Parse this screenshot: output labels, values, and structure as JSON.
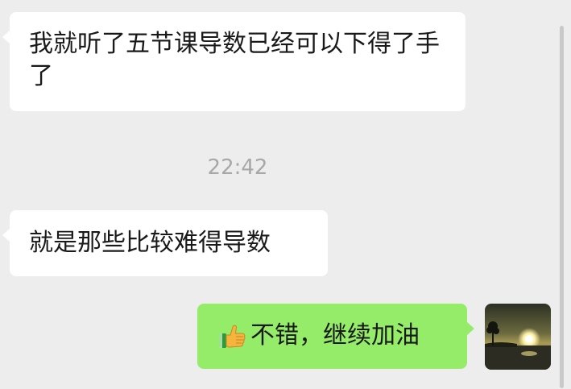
{
  "messages": [
    {
      "direction": "incoming",
      "text": "我就听了五节课导数已经可以下得了手了"
    },
    {
      "direction": "incoming",
      "text": "就是那些比较难得导数"
    },
    {
      "direction": "outgoing",
      "emoji": "thumbs-up-icon",
      "text": "不错，继续加油"
    }
  ],
  "timestamp": "22:42",
  "colors": {
    "background": "#ededed",
    "incoming_bubble": "#ffffff",
    "outgoing_bubble": "#95ec69",
    "timestamp_text": "#a8a8a8"
  },
  "avatar": {
    "icon": "sunset-landscape-avatar"
  }
}
